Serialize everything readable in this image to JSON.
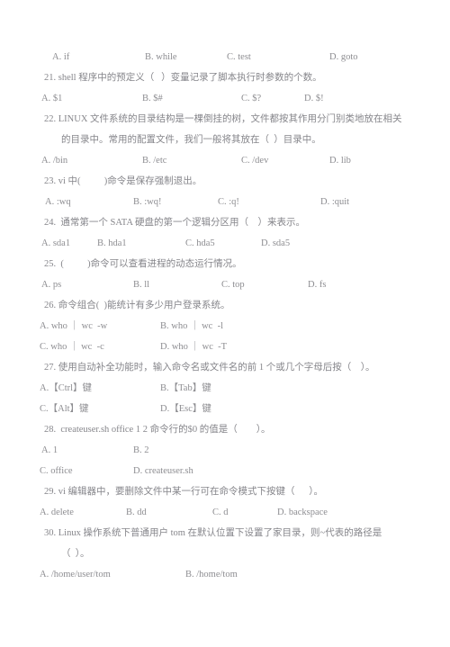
{
  "document": {
    "type": "exam-paper",
    "language": "zh-CN",
    "subject_hint": "Linux / shell",
    "text_color": "#8d8d91",
    "background_color": "#ffffff"
  },
  "q20_options": {
    "a": "A. if",
    "b": "B. while",
    "c": "C. test",
    "d": "D. goto"
  },
  "q21": {
    "stem": "21. shell 程序中的预定义（   ）变量记录了脚本执行时参数的个数。",
    "a": "A. $1",
    "b": "B. $#",
    "c": "C. $?",
    "d": "D. $!"
  },
  "q22": {
    "stem_line1": "22. LINUX 文件系统的目录结构是一棵倒挂的树，文件都按其作用分门别类地放在相关",
    "stem_line2": "的目录中。常用的配置文件，我们一般将其放在（  ）目录中。",
    "a": "A. /bin",
    "b": "B. /etc",
    "c": "C. /dev",
    "d": "D. lib"
  },
  "q23": {
    "stem": "23. vi 中(          )命令是保存强制退出。",
    "a": "A. :wq",
    "b": "B. :wq!",
    "c": "C. :q!",
    "d": "D. :quit"
  },
  "q24": {
    "stem": "24.  通常第一个 SATA 硬盘的第一个逻辑分区用（    ）来表示。",
    "a": "A. sda1",
    "b": "B. hda1",
    "c": "C. hda5",
    "d": "D. sda5"
  },
  "q25": {
    "stem": "25.  (          )命令可以查看进程的动态运行情况。",
    "a": "A. ps",
    "b": "B. ll",
    "c": "C. top",
    "d": "D. fs"
  },
  "q26": {
    "stem": "26. 命令组合(  )能统计有多少用户登录系统。",
    "a": "A. who ｜ wc  -w",
    "b": "B. who ｜ wc  -l",
    "c": "C. who ｜ wc  -c",
    "d": "D. who ｜ wc  -T"
  },
  "q27": {
    "stem": "27. 使用自动补全功能时，输入命令名或文件名的前 1 个或几个字母后按（    ）。",
    "a": "A.【Ctrl】键",
    "b": "B.【Tab】键",
    "c": "C.【Alt】键",
    "d": "D.【Esc】键"
  },
  "q28": {
    "stem": "28.  createuser.sh office 1 2 命令行的$0 的值是（        ）。",
    "a": "A. 1",
    "b": "B. 2",
    "c": "C. office",
    "d": "D. createuser.sh"
  },
  "q29": {
    "stem": "29. vi 编辑器中，要删除文件中某一行可在命令模式下按键（      ）。",
    "a": "A. delete",
    "b": "B. dd",
    "c": "C. d",
    "d": "D. backspace"
  },
  "q30": {
    "stem_line1": "30. Linux 操作系统下普通用户 tom 在默认位置下设置了家目录，则~代表的路径是",
    "stem_line2": "（  ）。",
    "a": "A. /home/user/tom",
    "b": "B. /home/tom"
  }
}
